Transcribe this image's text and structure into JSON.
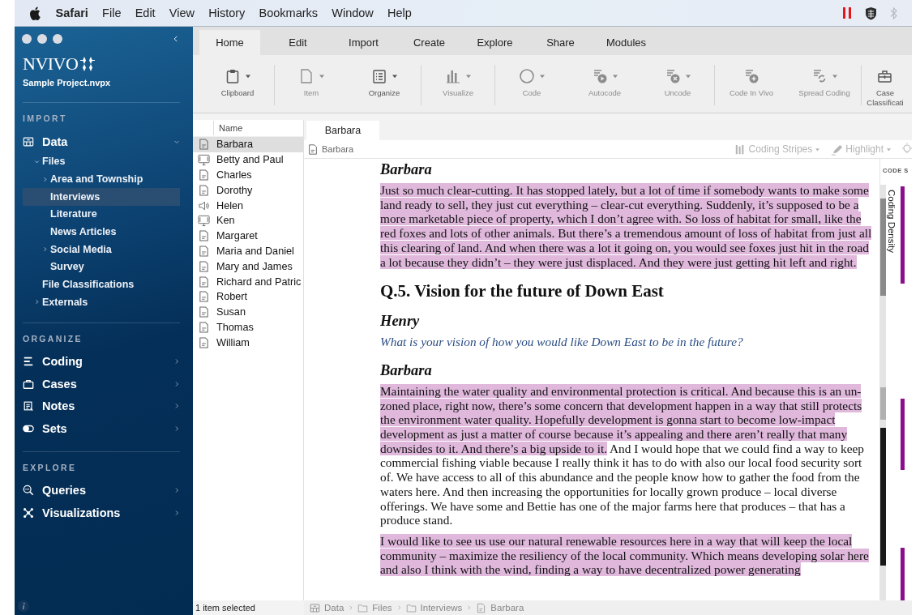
{
  "menubar": {
    "app": "Safari",
    "menus": [
      "File",
      "Edit",
      "View",
      "History",
      "Bookmarks",
      "Window",
      "Help"
    ]
  },
  "sidebar": {
    "logo": "NVIVO",
    "project": "Sample Project.nvpx",
    "sections": [
      {
        "title": "IMPORT",
        "items": [
          {
            "label": "Data",
            "expanded": true,
            "selected": false,
            "children": [
              {
                "label": "Files",
                "expanded": true,
                "selected": false,
                "children": [
                  {
                    "label": "Area and Township",
                    "expanded": false,
                    "selected": false
                  },
                  {
                    "label": "Interviews",
                    "selected": true
                  },
                  {
                    "label": "Literature",
                    "selected": false
                  },
                  {
                    "label": "News Articles",
                    "selected": false
                  },
                  {
                    "label": "Social Media",
                    "expanded": false,
                    "selected": false
                  },
                  {
                    "label": "Survey",
                    "selected": false
                  }
                ]
              },
              {
                "label": "File Classifications",
                "selected": false
              },
              {
                "label": "Externals",
                "expanded": false,
                "selected": false
              }
            ]
          }
        ]
      },
      {
        "title": "ORGANIZE",
        "items": [
          {
            "label": "Coding",
            "expanded": false,
            "selected": false
          },
          {
            "label": "Cases",
            "expanded": false,
            "selected": false
          },
          {
            "label": "Notes",
            "expanded": false,
            "selected": false
          },
          {
            "label": "Sets",
            "expanded": false,
            "selected": false
          }
        ]
      },
      {
        "title": "EXPLORE",
        "items": [
          {
            "label": "Queries",
            "expanded": false,
            "selected": false
          },
          {
            "label": "Visualizations",
            "expanded": false,
            "selected": false
          }
        ]
      }
    ]
  },
  "ribbon": {
    "tabs": [
      {
        "label": "Home",
        "selected": true
      },
      {
        "label": "Edit",
        "selected": false
      },
      {
        "label": "Import",
        "selected": false
      },
      {
        "label": "Create",
        "selected": false
      },
      {
        "label": "Explore",
        "selected": false
      },
      {
        "label": "Share",
        "selected": false
      },
      {
        "label": "Modules",
        "selected": false
      }
    ],
    "groups": [
      {
        "tools": [
          {
            "label": "Clipboard",
            "disabled": false,
            "dropdown": true
          }
        ]
      },
      {
        "tools": [
          {
            "label": "Item",
            "disabled": true,
            "dropdown": true
          },
          {
            "label": "Organize",
            "disabled": false,
            "dropdown": true
          }
        ]
      },
      {
        "tools": [
          {
            "label": "Visualize",
            "disabled": true,
            "dropdown": true
          }
        ]
      },
      {
        "tools": [
          {
            "label": "Code",
            "disabled": true,
            "dropdown": true
          },
          {
            "label": "Autocode",
            "disabled": true,
            "dropdown": true
          },
          {
            "label": "Uncode",
            "disabled": true,
            "dropdown": true
          }
        ]
      },
      {
        "tools": [
          {
            "label": "Code In Vivo",
            "disabled": true,
            "dropdown": false
          },
          {
            "label": "Spread Coding",
            "disabled": true,
            "dropdown": true
          }
        ]
      },
      {
        "tools": [
          {
            "label": "Case Classificati",
            "disabled": false,
            "dropdown": false
          }
        ]
      }
    ]
  },
  "file_list": {
    "column": "Name",
    "items": [
      {
        "name": "Barbara",
        "kind": "document",
        "selected": true
      },
      {
        "name": "Betty and Paul",
        "kind": "video",
        "selected": false
      },
      {
        "name": "Charles",
        "kind": "document",
        "selected": false
      },
      {
        "name": "Dorothy",
        "kind": "document",
        "selected": false
      },
      {
        "name": "Helen",
        "kind": "audio",
        "selected": false
      },
      {
        "name": "Ken",
        "kind": "video",
        "selected": false
      },
      {
        "name": "Margaret",
        "kind": "document",
        "selected": false
      },
      {
        "name": "Maria and Daniel",
        "kind": "document",
        "selected": false
      },
      {
        "name": "Mary and James",
        "kind": "document",
        "selected": false
      },
      {
        "name": "Richard and Patric",
        "kind": "document",
        "selected": false
      },
      {
        "name": "Robert",
        "kind": "document",
        "selected": false
      },
      {
        "name": "Susan",
        "kind": "document",
        "selected": false
      },
      {
        "name": "Thomas",
        "kind": "document",
        "selected": false
      },
      {
        "name": "William",
        "kind": "document",
        "selected": false
      }
    ],
    "status": "1 item selected"
  },
  "document": {
    "tabs": [
      {
        "label": "Barbara",
        "selected": true
      }
    ],
    "toolbar": {
      "title": "Barbara",
      "tools": [
        {
          "label": "Coding Stripes",
          "disabled": true
        },
        {
          "label": "Highlight",
          "disabled": true
        }
      ]
    },
    "blocks": [
      {
        "kind": "speaker",
        "text": "Barbara"
      },
      {
        "kind": "paragraph",
        "segments": [
          {
            "text": "Just so much clear-cutting. It has stopped lately, but a lot of time if somebody wants to make some land ready to sell, they just cut everything – clear-cut everything. Suddenly, it’s supposed to be a more marketable piece of property, which I don’t agree with. So loss of habitat for small, like the red foxes and lots of other animals. But there’s a tremendous amount of loss of habitat from just all this clearing of land. And when there was a lot it going on, you would see foxes just hit in the road a lot because they didn’t – they were just displaced. And they were just getting hit left and right.",
            "coded": true
          }
        ]
      },
      {
        "kind": "heading",
        "text": "Q.5. Vision for the future of Down East"
      },
      {
        "kind": "speaker",
        "text": "Henry"
      },
      {
        "kind": "question",
        "text": "What is your vision of how you would like Down East to be in the future?"
      },
      {
        "kind": "speaker",
        "text": "Barbara"
      },
      {
        "kind": "paragraph",
        "segments": [
          {
            "text": "Maintaining the water quality and environmental protection is critical. And because this is an un-zoned place, right now, there’s some concern that development happen in a way that still protects the environment water quality. Hopefully development is gonna start to become low-impact development as just a matter of course because it’s appealing and there aren’t really that many downsides to it. And there’s a big upside to it.",
            "coded": true
          },
          {
            "text": " And I would hope that we could find a way to keep commercial fishing viable because I really think it has to do with also our local food security sort of. We have access to all of this abundance and the people know how to gather the food from the waters here. And then increasing the opportunities for locally grown produce – local diverse offerings. We have some and Bettie has one of the major farms here that produces – that has a produce stand.",
            "coded": false
          }
        ]
      },
      {
        "kind": "paragraph",
        "segments": [
          {
            "text": "I would like to see us use our natural renewable resources here in a way that will keep the local community – maximize the resiliency of the local community. Which means developing solar here and also I think with the wind, finding a way to have decentralized power generating",
            "coded": true
          }
        ]
      }
    ]
  },
  "coding_panel": {
    "title": "CODE S",
    "density_label": "Coding Density"
  },
  "breadcrumb": [
    "Data",
    "Files",
    "Interviews",
    "Barbara"
  ]
}
